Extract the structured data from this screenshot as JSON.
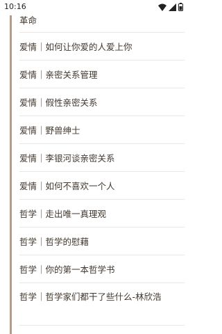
{
  "status": {
    "time": "10:16"
  },
  "items": [
    {
      "label": "革命"
    },
    {
      "label": "爱情｜如何让你爱的人爱上你"
    },
    {
      "label": "爱情｜亲密关系管理"
    },
    {
      "label": "爱情｜假性亲密关系"
    },
    {
      "label": "爱情｜野兽绅士"
    },
    {
      "label": "爱情｜李银河谈亲密关系"
    },
    {
      "label": "爱情｜如何不喜欢一个人"
    },
    {
      "label": "哲学｜走出唯一真理观"
    },
    {
      "label": "哲学｜哲学的慰藉"
    },
    {
      "label": "哲学｜你的第一本哲学书"
    },
    {
      "label": "哲学｜哲学家们都干了些什么-林欣浩"
    }
  ],
  "colors": {
    "accent_rule": "#b79a87",
    "divider": "#ece7e3",
    "text": "#43392f"
  }
}
